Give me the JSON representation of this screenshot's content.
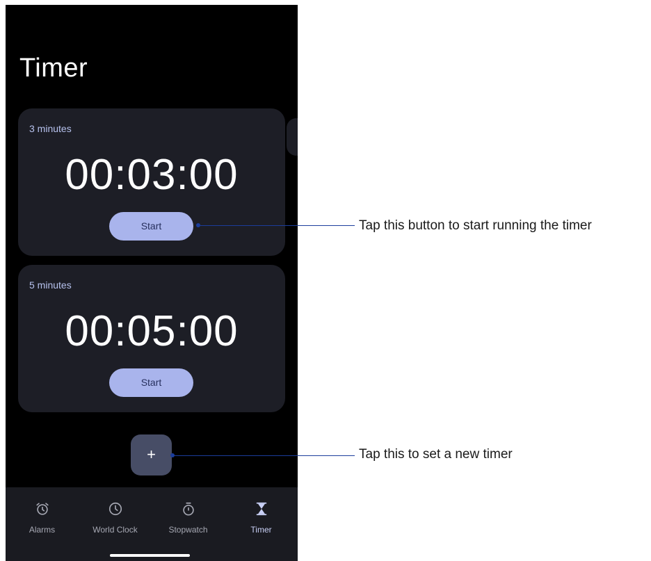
{
  "app": {
    "title": "Timer"
  },
  "timers": [
    {
      "label": "3 minutes",
      "time": "00:03:00",
      "start_label": "Start"
    },
    {
      "label": "5 minutes",
      "time": "00:05:00",
      "start_label": "Start"
    }
  ],
  "fab": {
    "label": "+"
  },
  "nav": {
    "items": [
      {
        "label": "Alarms",
        "icon": "alarm-clock-icon",
        "active": false
      },
      {
        "label": "World Clock",
        "icon": "clock-icon",
        "active": false
      },
      {
        "label": "Stopwatch",
        "icon": "stopwatch-icon",
        "active": false
      },
      {
        "label": "Timer",
        "icon": "hourglass-icon",
        "active": true
      }
    ]
  },
  "callouts": [
    {
      "text": "Tap this button to start running the timer"
    },
    {
      "text": "Tap this to set a new timer"
    }
  ],
  "colors": {
    "background": "#000000",
    "card": "#1d1e26",
    "accent": "#a9b4ec",
    "fab": "#474d66",
    "callout_line": "#1b3d9c"
  }
}
